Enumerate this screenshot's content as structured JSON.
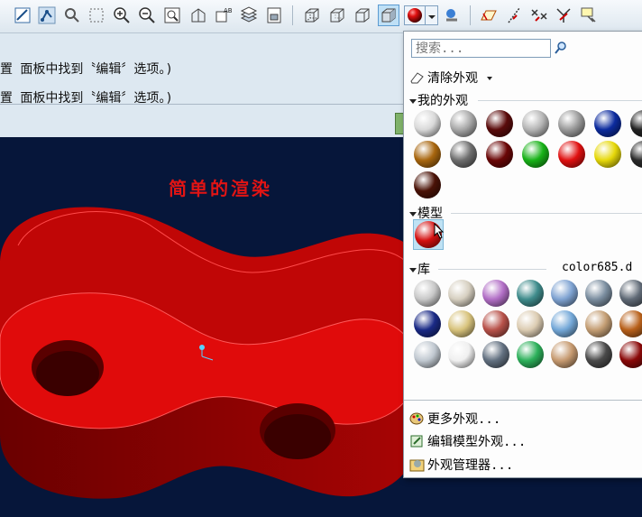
{
  "toolbar": {
    "icons": [
      "refit-icon",
      "datum-display-icon",
      "spin-center-icon",
      "selection-box-icon",
      "zoom-in-icon",
      "zoom-out-icon",
      "zoom-window-icon",
      "reorient-icon",
      "saved-views-icon",
      "layers-icon",
      "view-manager-icon",
      "wireframe-icon",
      "hidden-line-icon",
      "no-hidden-icon",
      "shading-icon",
      "appearance-gallery-icon",
      "dropdown-arrow-icon",
      "scene-icon",
      "datum-planes-icon",
      "datum-axes-icon",
      "datum-points-icon",
      "csys-icon",
      "annotation-icon"
    ]
  },
  "messages": [
    "置 面板中找到〝编辑〞选项。)",
    "置 面板中找到〝编辑〞选项。)"
  ],
  "viewport": {
    "title": "简单的渲染",
    "model_color": "#e00b0b",
    "background": "#06163a"
  },
  "appearance_popup": {
    "search_placeholder": "搜索...",
    "clear_label": "清除外观",
    "my_appearances_label": "我的外观",
    "model_label": "模型",
    "library_label": "库",
    "library_file": "color685.d",
    "more_label": "更多外观...",
    "edit_label": "编辑模型外观...",
    "manager_label": "外观管理器...",
    "my_colors": [
      "#d9d9d9",
      "#a8a8a8",
      "#5a0b0b",
      "#b5b5b5",
      "#9a9a9a",
      "#0c2b9e",
      "#222222",
      "#a8660e",
      "#6e6e6e",
      "#6a0606",
      "#18b218",
      "#e01010",
      "#e6d80a",
      "#2a2a2a",
      "#4a1206"
    ],
    "model_colors": [
      "#d41010"
    ],
    "library_colors": [
      "#c8c8c8",
      "#d6cfc0",
      "#b26fc6",
      "#3f8c8c",
      "#7fa3d2",
      "#7b8ea0",
      "#606a76",
      "#1a2a86",
      "#d8c37c",
      "#b8524a",
      "#dcccb2",
      "#74a8d8",
      "#c49e74",
      "#b8601a",
      "#c0c8d0",
      "#f0f0f0",
      "#627080",
      "#2cb05a",
      "#c69a70",
      "#4a4a4a",
      "#8a0808"
    ]
  }
}
